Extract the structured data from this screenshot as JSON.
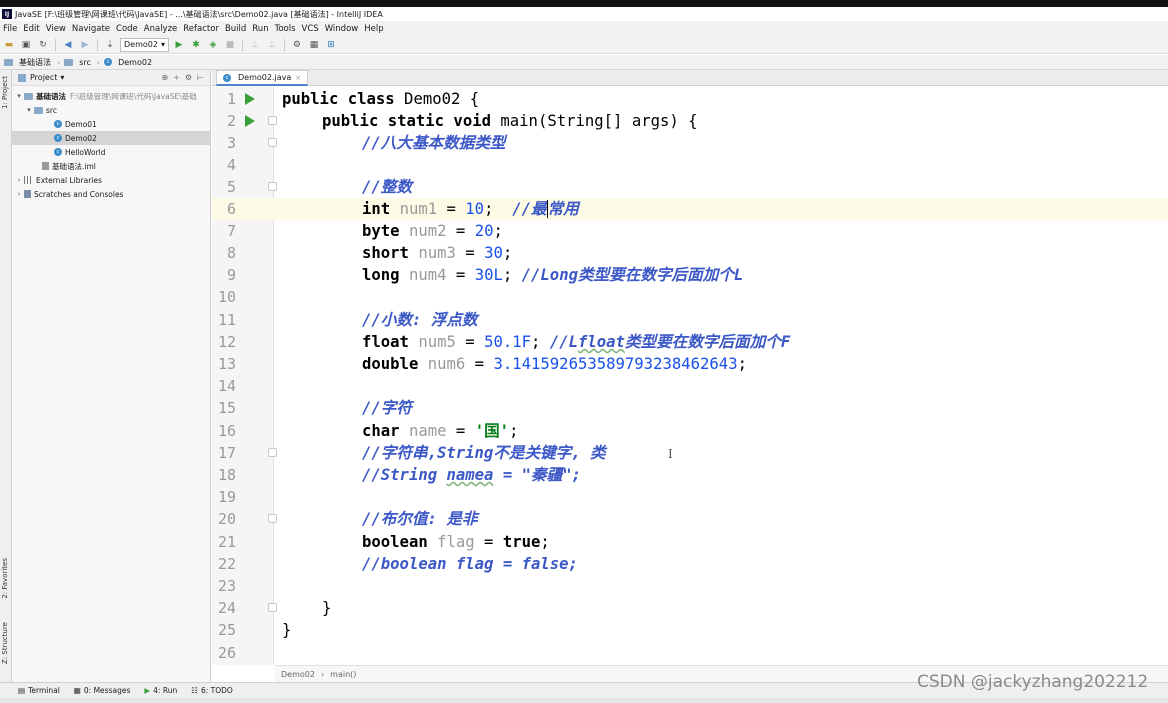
{
  "window": {
    "title": "JavaSE [F:\\班级管理\\网课班\\代码\\JavaSE] - ...\\基础语法\\src\\Demo02.java [基础语法] - IntelliJ IDEA",
    "logo_text": "IJ"
  },
  "menu": [
    "File",
    "Edit",
    "View",
    "Navigate",
    "Code",
    "Analyze",
    "Refactor",
    "Build",
    "Run",
    "Tools",
    "VCS",
    "Window",
    "Help"
  ],
  "toolbar": {
    "run_config": "Demo02",
    "icons": [
      "open-icon",
      "save-icon",
      "sync-icon",
      "back-icon",
      "forward-icon",
      "build-icon",
      "run-icon",
      "debug-icon",
      "coverage-icon",
      "stop-icon",
      "profile-icon",
      "vcs-icon",
      "settings-icon",
      "structure-icon",
      "sdk-icon"
    ]
  },
  "navbar": {
    "crumbs": [
      "基础语法",
      "src",
      "Demo02"
    ]
  },
  "left_stripe": {
    "project_tab": "1: Project",
    "favorites_tab": "2: Favorites",
    "structure_tab": "Z: Structure"
  },
  "project_panel": {
    "title": "Project",
    "module": "基础语法",
    "module_path": "F:\\班级管理\\网课班\\代码\\JavaSE\\基础",
    "src": "src",
    "classes": [
      "Demo01",
      "Demo02",
      "HelloWorld"
    ],
    "iml": "基础语法.iml",
    "external_libraries": "External Libraries",
    "scratches": "Scratches and Consoles"
  },
  "editor": {
    "tab": "Demo02.java",
    "line_numbers": [
      "1",
      "2",
      "3",
      "4",
      "5",
      "6",
      "7",
      "8",
      "9",
      "10",
      "11",
      "12",
      "13",
      "14",
      "15",
      "16",
      "17",
      "18",
      "19",
      "20",
      "21",
      "22",
      "23",
      "24",
      "25",
      "26"
    ],
    "lines": {
      "l1": {
        "kw": "public class",
        "rest": " Demo02 {"
      },
      "l2": {
        "kw": "public static void",
        "rest": " main(String[] args) {"
      },
      "l3": {
        "cmt": "//八大基本数据类型"
      },
      "l5": {
        "cmt": "//整数"
      },
      "l6": {
        "kw": "int",
        "var": "num1",
        "eq": " = ",
        "num": "10",
        "semi": ";  ",
        "cmt_a": "//最",
        "cmt_b": "常用"
      },
      "l7": {
        "kw": "byte",
        "var": "num2",
        "eq": " = ",
        "num": "20",
        "semi": ";"
      },
      "l8": {
        "kw": "short",
        "var": "num3",
        "eq": " = ",
        "num": "30",
        "semi": ";"
      },
      "l9": {
        "kw": "long",
        "var": "num4",
        "eq": " = ",
        "num": "30L",
        "semi": "; ",
        "cmt": "//Long类型要在数字后面加个L"
      },
      "l11": {
        "cmt": "//小数: 浮点数"
      },
      "l12": {
        "kw": "float",
        "var": "num5",
        "eq": " = ",
        "num": "50.1F",
        "semi": "; ",
        "cmt_a": "//L",
        "cmt_und": "float",
        "cmt_b": "类型要在数字后面加个F"
      },
      "l13": {
        "kw": "double",
        "var": "num6",
        "eq": " = ",
        "num": "3.14159265358979323846264",
        "num_end": "3",
        "semi": ";"
      },
      "l15": {
        "cmt": "//字符"
      },
      "l16": {
        "kw": "char",
        "var": "name",
        "eq": " = ",
        "str": "'国'",
        "semi": ";"
      },
      "l17": {
        "cmt": "//字符串,String不是关键字, 类"
      },
      "l18": {
        "cmt_a": "//String ",
        "cmt_und": "namea",
        "cmt_b": " = \"秦疆\";"
      },
      "l20": {
        "cmt": "//布尔值: 是非"
      },
      "l21": {
        "kw": "boolean",
        "var": "flag",
        "eq": " = ",
        "kw_val": "true",
        "semi": ";"
      },
      "l22": {
        "cmt": "//boolean flag = false;"
      },
      "l24": {
        "rest": "}"
      },
      "l25": {
        "rest": "}"
      }
    },
    "crumbs": [
      "Demo02",
      "main()"
    ]
  },
  "bottom_tools": [
    {
      "label": "Terminal",
      "icon": "terminal-icon"
    },
    {
      "label": "0: Messages",
      "icon": "messages-icon"
    },
    {
      "label": "4: Run",
      "icon": "run-icon"
    },
    {
      "label": "6: TODO",
      "icon": "todo-icon"
    }
  ],
  "watermark": "CSDN @jackyzhang202212",
  "colors": {
    "keyword": "#000080",
    "comment": "#3c58c7",
    "number": "#1750eb",
    "string": "#067d17",
    "run_marker": "#3a9e3a",
    "current_line": "#fdfbe6"
  }
}
